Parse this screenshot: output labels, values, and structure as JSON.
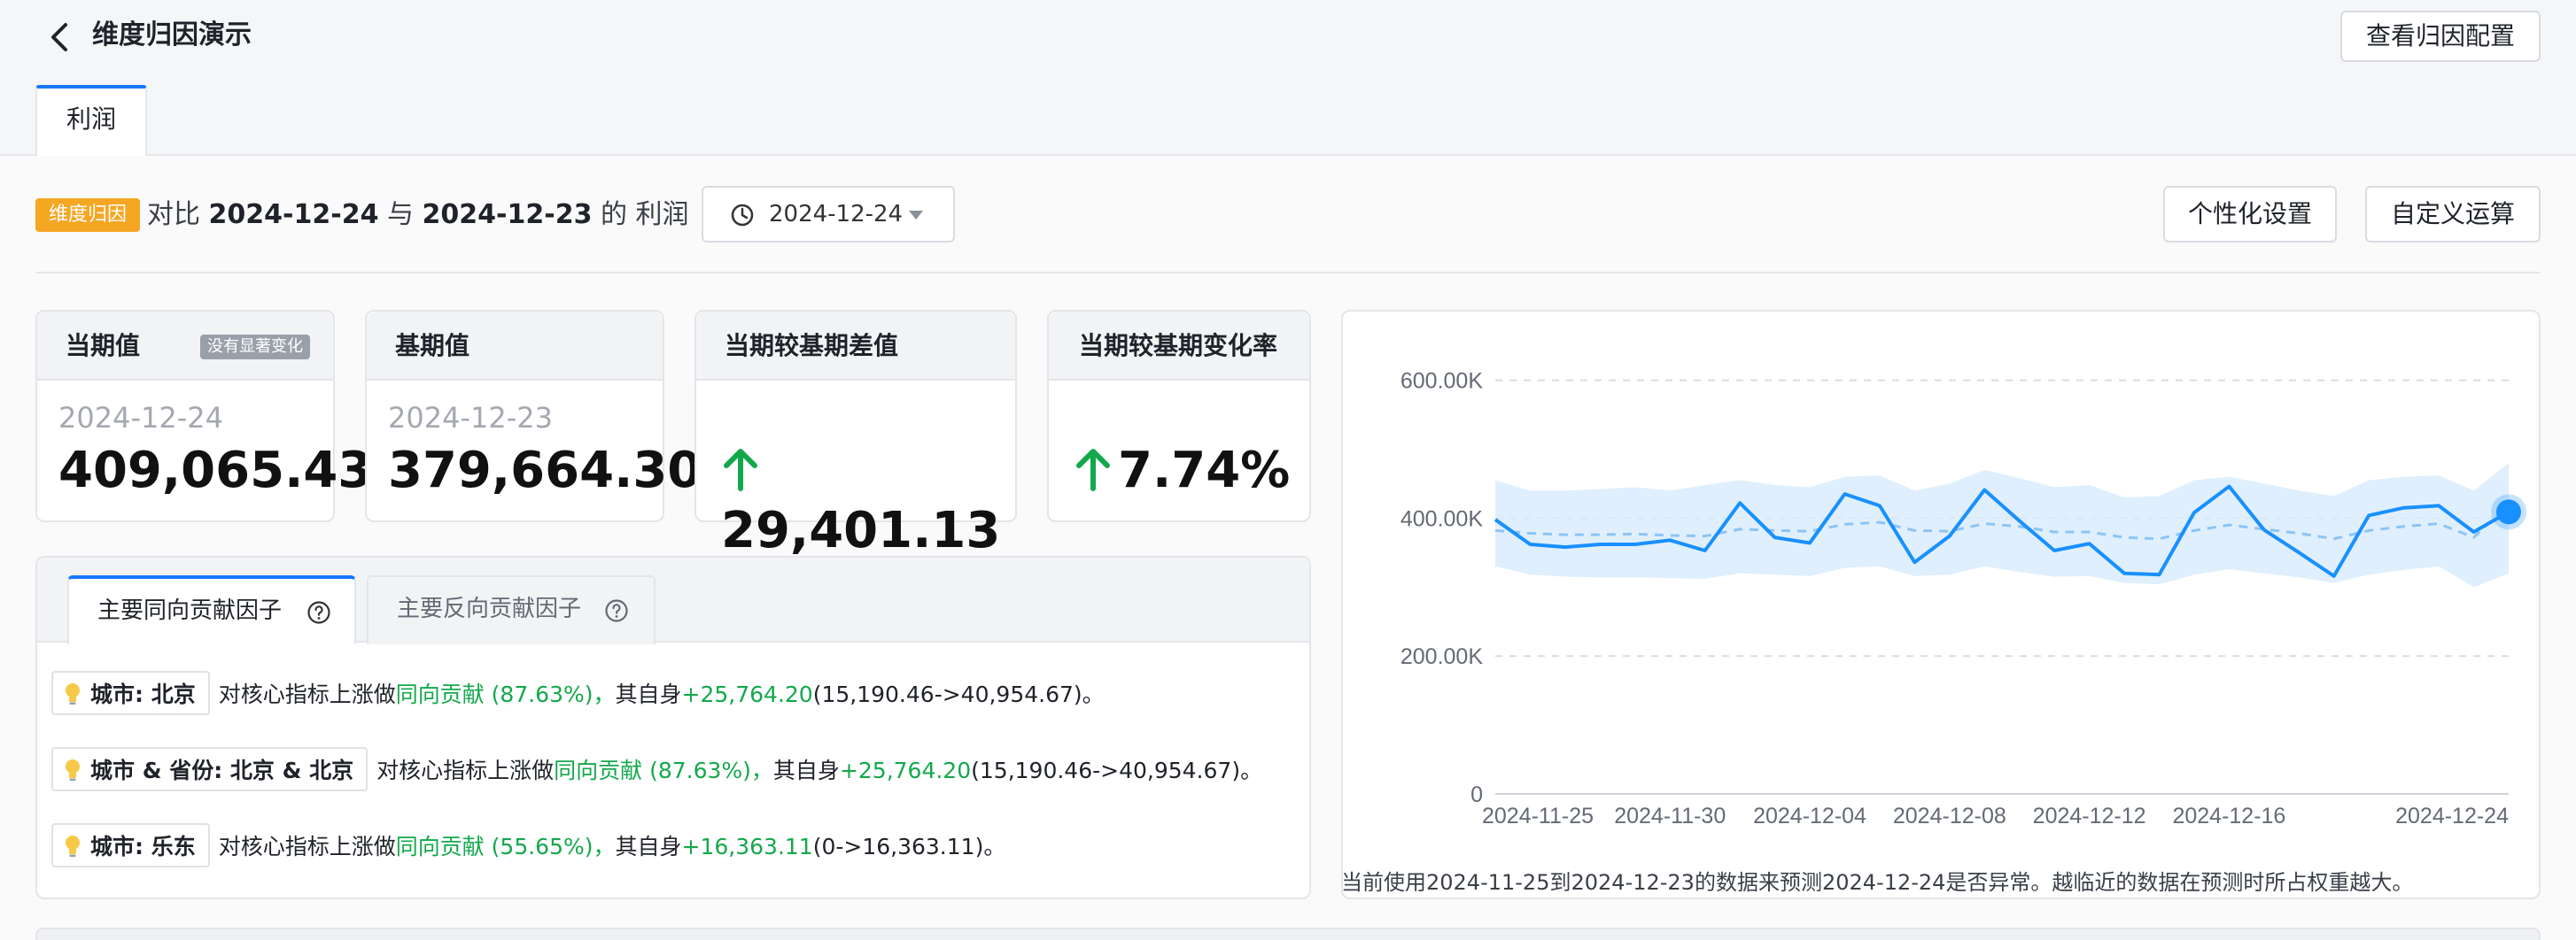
{
  "header": {
    "title": "维度归因演示",
    "config_button": "查看归因配置"
  },
  "tabs": [
    {
      "label": "利润",
      "active": true
    }
  ],
  "summary": {
    "badge": "维度归因",
    "prefix": "对比",
    "current_date": "2024-12-24",
    "connector": "与",
    "base_date": "2024-12-23",
    "particle": "的",
    "metric": "利润"
  },
  "date_picker": {
    "value": "2024-12-24",
    "icon": "clock-icon"
  },
  "actions": {
    "personalize": "个性化设置",
    "custom_calc": "自定义运算"
  },
  "cards": {
    "current": {
      "title": "当期值",
      "badge": "没有显著变化",
      "date": "2024-12-24",
      "value": "409,065.43"
    },
    "base": {
      "title": "基期值",
      "date": "2024-12-23",
      "value": "379,664.30"
    },
    "diff": {
      "title": "当期较基期差值",
      "value": "29,401.13",
      "direction": "up"
    },
    "rate": {
      "title": "当期较基期变化率",
      "value": "7.74%",
      "direction": "up"
    }
  },
  "factors": {
    "tabs": [
      {
        "label": "主要同向贡献因子",
        "active": true
      },
      {
        "label": "主要反向贡献因子",
        "active": false
      }
    ],
    "rows": [
      {
        "tag": "城市: 北京",
        "text": "对核心指标上涨做",
        "contribution": "同向贡献 (87.63%)，",
        "self_text": "其自身",
        "delta": "+25,764.20",
        "range": "(15,190.46->40,954.67)。"
      },
      {
        "tag": "城市 & 省份: 北京 & 北京",
        "text": "对核心指标上涨做",
        "contribution": "同向贡献 (87.63%)，",
        "self_text": "其自身",
        "delta": "+25,764.20",
        "range": "(15,190.46->40,954.67)。"
      },
      {
        "tag": "城市: 乐东",
        "text": "对核心指标上涨做",
        "contribution": "同向贡献 (55.65%)，",
        "self_text": "其自身",
        "delta": "+16,363.11",
        "range": "(0->16,363.11)。"
      }
    ]
  },
  "colors": {
    "accent": "#1677ff",
    "badge": "#f5a623",
    "positive": "#14a84c",
    "line": "#1890ff",
    "band": "#d8ebfd"
  },
  "chart_data": {
    "type": "line",
    "x": [
      "2024-11-25",
      "2024-11-26",
      "2024-11-27",
      "2024-11-28",
      "2024-11-29",
      "2024-11-30",
      "2024-12-01",
      "2024-12-02",
      "2024-12-03",
      "2024-12-04",
      "2024-12-05",
      "2024-12-06",
      "2024-12-07",
      "2024-12-08",
      "2024-12-09",
      "2024-12-10",
      "2024-12-11",
      "2024-12-12",
      "2024-12-13",
      "2024-12-14",
      "2024-12-15",
      "2024-12-16",
      "2024-12-17",
      "2024-12-18",
      "2024-12-19",
      "2024-12-20",
      "2024-12-21",
      "2024-12-22",
      "2024-12-23",
      "2024-12-24"
    ],
    "xticks": [
      "2024-11-25",
      "2024-11-30",
      "2024-12-04",
      "2024-12-08",
      "2024-12-12",
      "2024-12-16",
      "2024-12-24"
    ],
    "yticks": [
      "600.00K",
      "400.00K",
      "200.00K",
      "0"
    ],
    "ylim": [
      0,
      620000
    ],
    "grid": true,
    "series": [
      {
        "role": "actual",
        "values": [
          398000,
          362000,
          358000,
          362000,
          362000,
          368000,
          353000,
          422000,
          372000,
          364000,
          435000,
          418000,
          336000,
          374000,
          441000,
          396000,
          353000,
          363000,
          320000,
          318000,
          408000,
          446000,
          383000,
          350000,
          316000,
          404000,
          415000,
          418000,
          380000,
          409065
        ]
      },
      {
        "role": "predicted",
        "values": [
          382000,
          378000,
          376000,
          376000,
          377000,
          375000,
          374000,
          384000,
          382000,
          381000,
          391000,
          394000,
          382000,
          381000,
          392000,
          388000,
          380000,
          380000,
          372000,
          370000,
          382000,
          390000,
          384000,
          378000,
          370000,
          382000,
          388000,
          392000,
          372000,
          420000
        ]
      },
      {
        "role": "upper",
        "values": [
          455000,
          440000,
          440000,
          442000,
          445000,
          440000,
          448000,
          455000,
          448000,
          445000,
          460000,
          462000,
          440000,
          450000,
          470000,
          458000,
          445000,
          448000,
          430000,
          432000,
          455000,
          460000,
          450000,
          440000,
          432000,
          455000,
          460000,
          462000,
          440000,
          480000
        ]
      },
      {
        "role": "lower",
        "values": [
          330000,
          318000,
          315000,
          314000,
          314000,
          313000,
          312000,
          320000,
          318000,
          316000,
          328000,
          330000,
          316000,
          318000,
          330000,
          322000,
          315000,
          316000,
          306000,
          304000,
          318000,
          326000,
          320000,
          314000,
          306000,
          318000,
          325000,
          330000,
          300000,
          320000
        ]
      }
    ],
    "highlight": {
      "x": "2024-12-24",
      "y": 409065
    }
  },
  "chart_note": "当前使用2024-11-25到2024-12-23的数据来预测2024-12-24是否异常。越临近的数据在预测时所占权重越大。"
}
